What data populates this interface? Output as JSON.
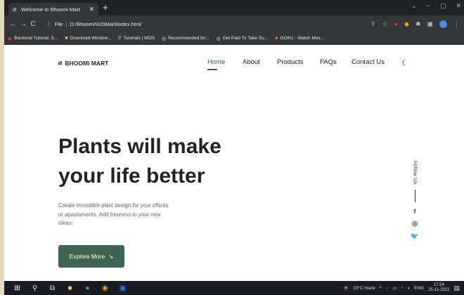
{
  "browser": {
    "tab_title": "Welcome to Bhoomi Mart",
    "address": {
      "scheme": "File",
      "url": "D:/Bhoomi%20Mart/index.html"
    },
    "bookmarks": [
      {
        "label": "Backend Tutorial: S...",
        "icon": "youtube-icon"
      },
      {
        "label": "Download Window...",
        "icon": "download-icon"
      },
      {
        "label": "Tutorials | MDN",
        "icon": "mdn-icon"
      },
      {
        "label": "Recommended for...",
        "icon": "globe-icon"
      },
      {
        "label": "Get Paid To Take Su...",
        "icon": "globe-icon"
      },
      {
        "label": "GOKU - Watch Mov...",
        "icon": "goku-icon"
      }
    ]
  },
  "site": {
    "logo": "BHOOMI MART",
    "nav": [
      "Home",
      "About",
      "Products",
      "FAQs",
      "Contact Us"
    ],
    "active_nav": "Home",
    "hero": {
      "title_line1": "Plants will make",
      "title_line2": "your life better",
      "description_line1": "Create incredible plant design for your offices",
      "description_line2": "or apastaments. Add fresness to your new",
      "description_line3": "ideas.",
      "cta": "Explore More"
    },
    "social": {
      "label": "Follow Us",
      "icons": [
        "facebook-icon",
        "instagram-icon",
        "twitter-icon"
      ]
    },
    "accent_color": "#3d6552"
  },
  "taskbar": {
    "weather": "23°C Haze",
    "language": "ENG",
    "time": "17:54",
    "date": "25-11-2022"
  }
}
